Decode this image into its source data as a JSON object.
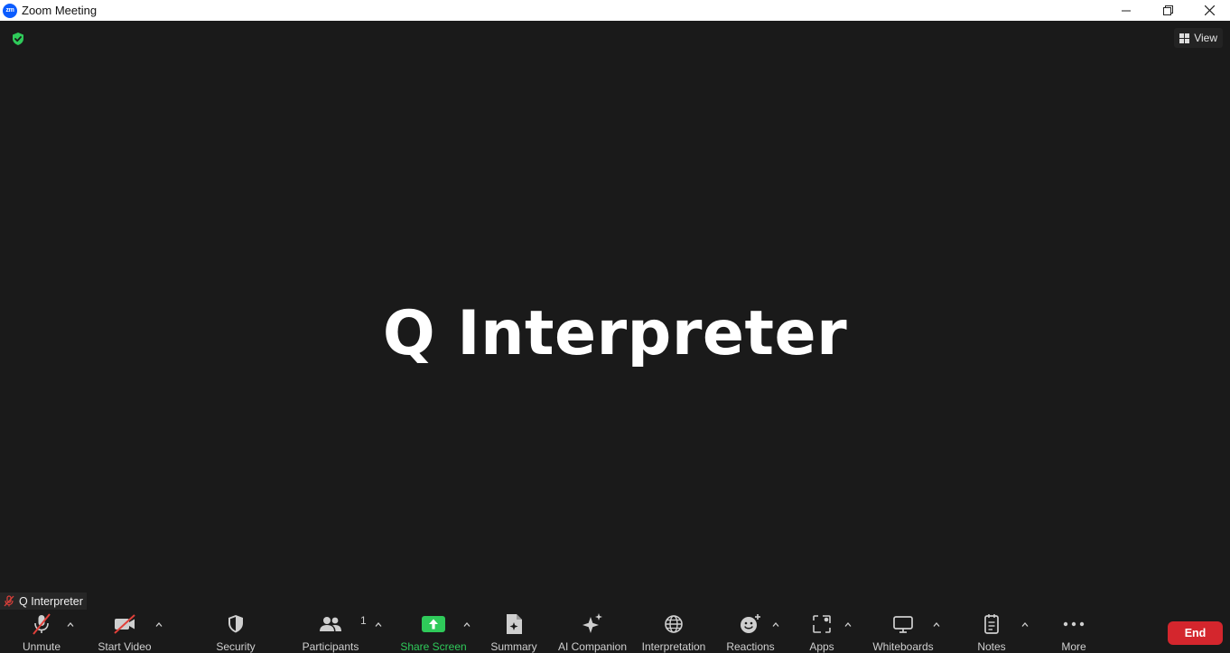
{
  "window": {
    "title": "Zoom Meeting",
    "logo_text": "zm"
  },
  "meeting": {
    "view_label": "View",
    "participant_display_name": "Q Interpreter",
    "name_tag": "Q Interpreter"
  },
  "toolbar": {
    "unmute": "Unmute",
    "start_video": "Start Video",
    "security": "Security",
    "participants": "Participants",
    "participants_count": "1",
    "share_screen": "Share Screen",
    "summary": "Summary",
    "ai_companion": "AI Companion",
    "interpretation": "Interpretation",
    "reactions": "Reactions",
    "apps": "Apps",
    "whiteboards": "Whiteboards",
    "notes": "Notes",
    "more": "More",
    "end": "End"
  },
  "colors": {
    "background": "#1a1a1a",
    "share_green": "#2fca5a",
    "end_red": "#d4262d",
    "muted_red": "#e0403a",
    "zoom_blue": "#0b5cff"
  }
}
